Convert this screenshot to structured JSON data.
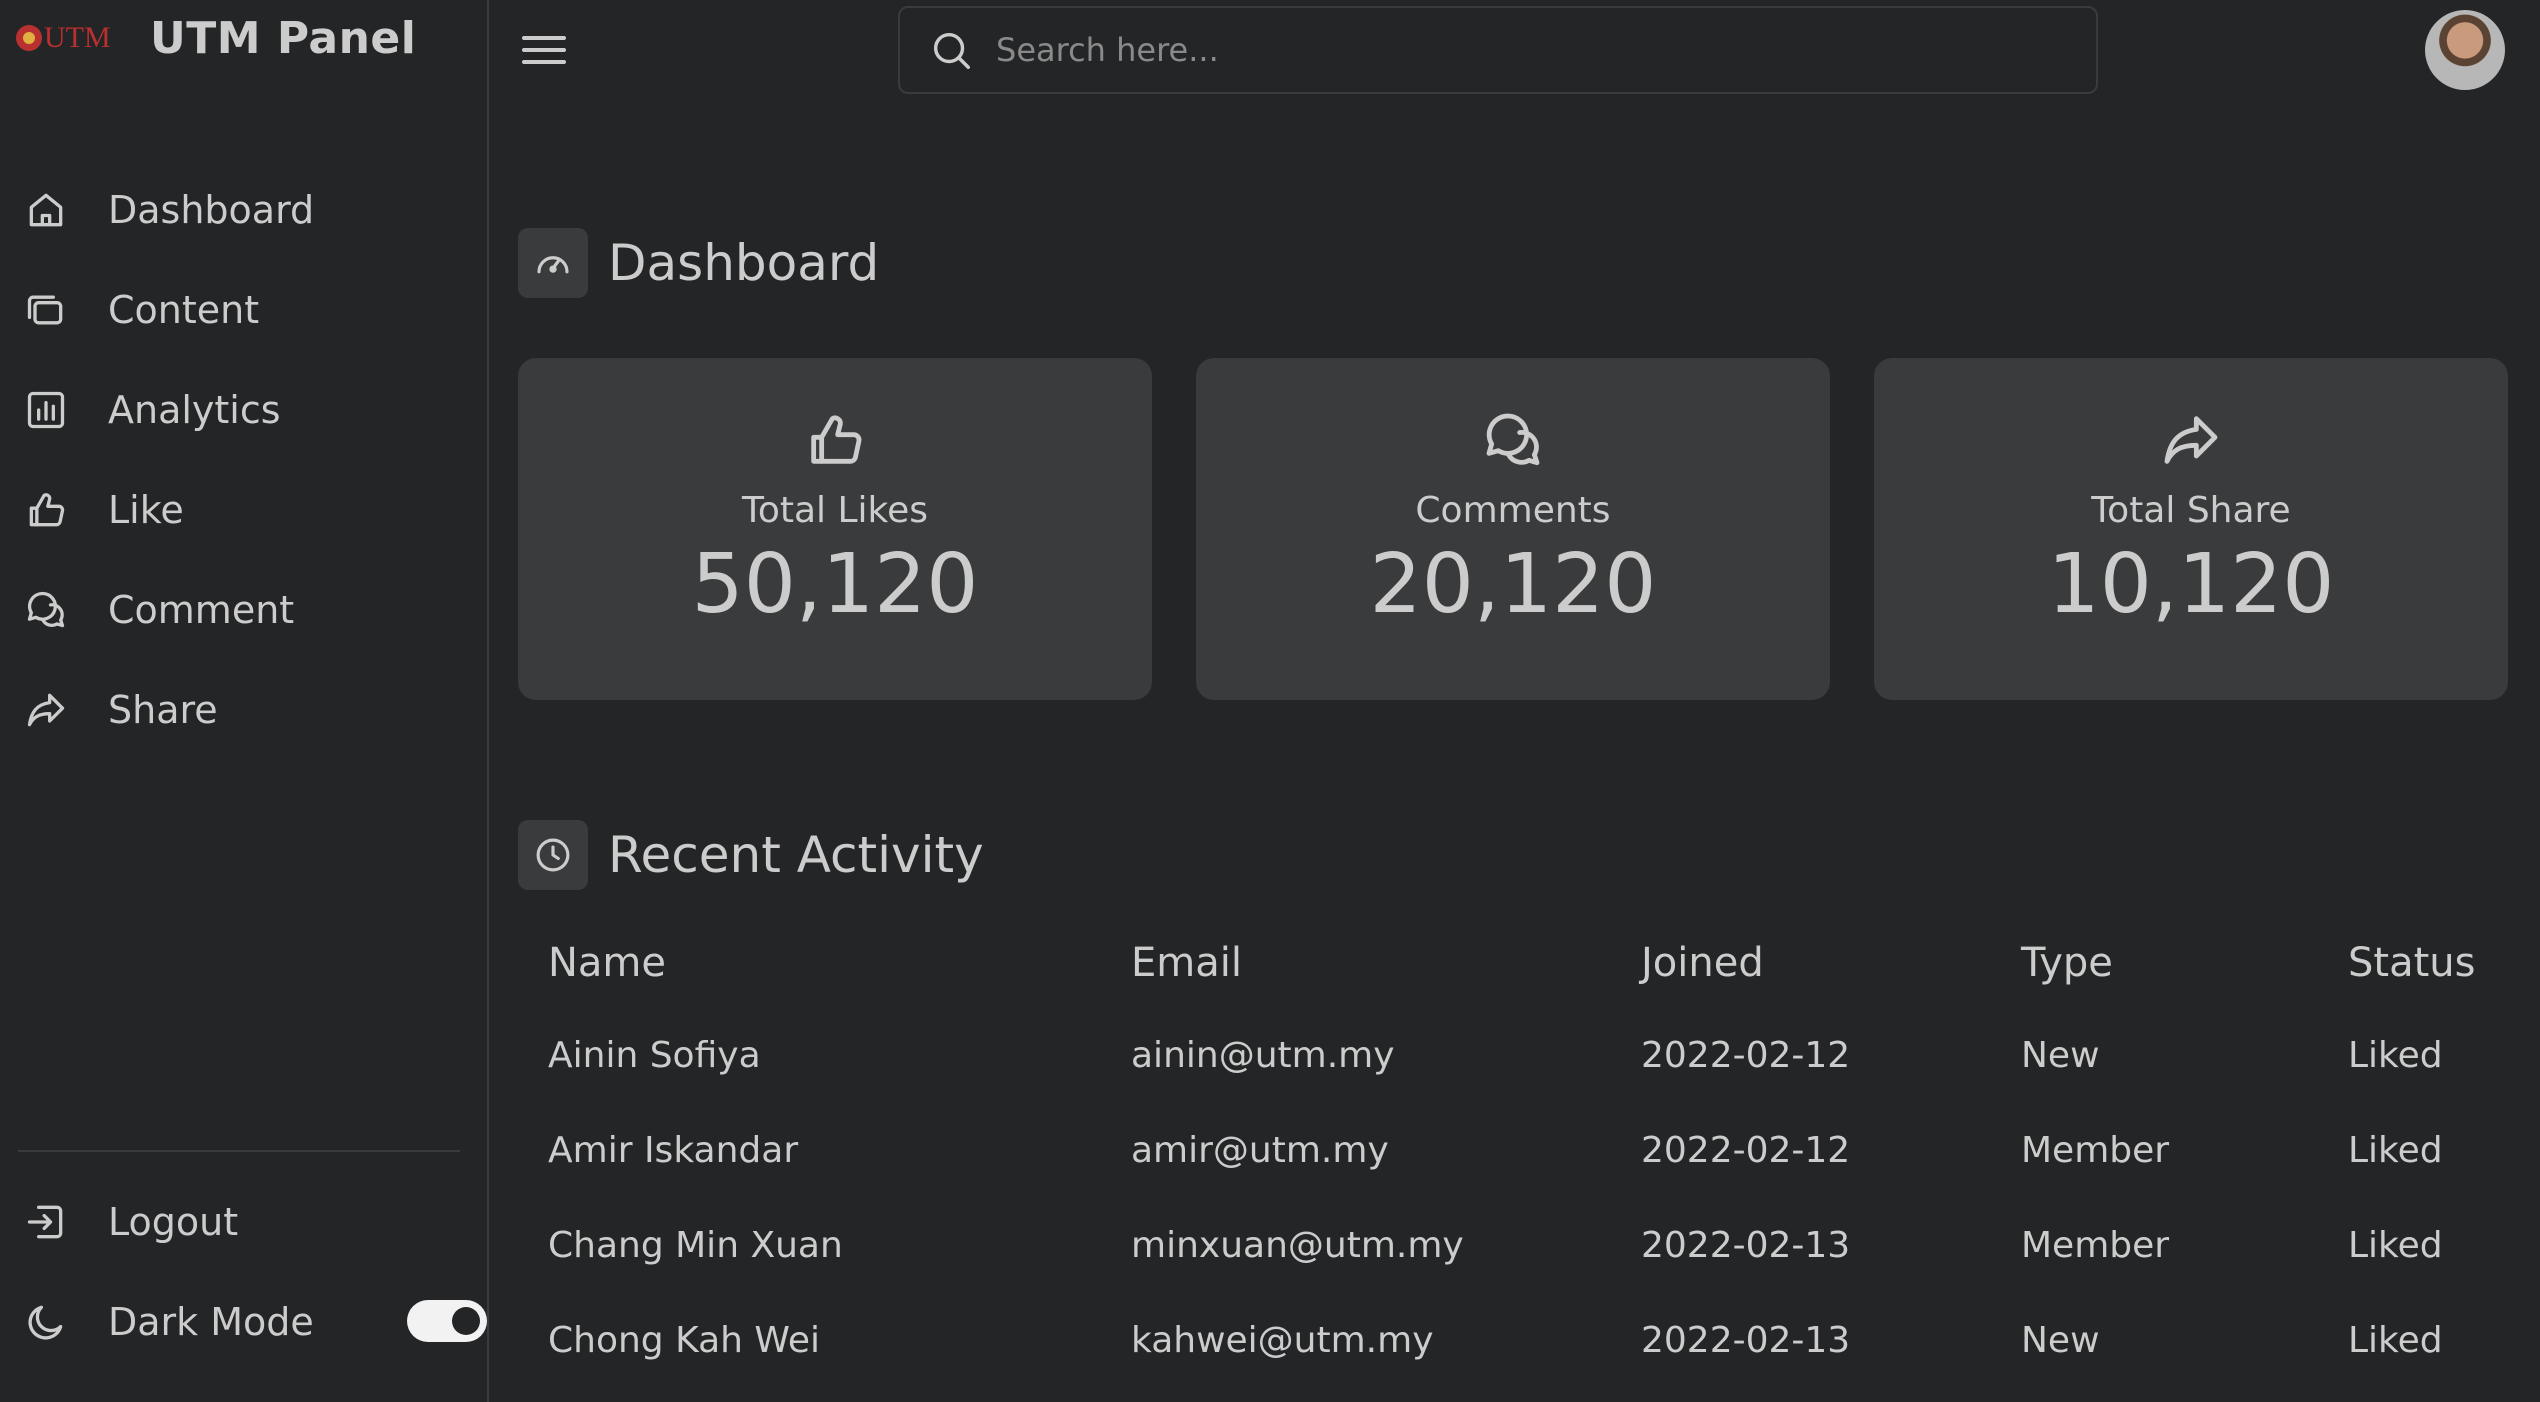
{
  "app": {
    "logo_text": "UTM",
    "title": "UTM Panel"
  },
  "colors": {
    "background": "#242526",
    "card": "#3a3b3c",
    "text": "#cccccc",
    "brand": "#b8302f"
  },
  "sidebar": {
    "items": [
      {
        "label": "Dashboard",
        "icon": "home-icon"
      },
      {
        "label": "Content",
        "icon": "files-icon"
      },
      {
        "label": "Analytics",
        "icon": "bar-chart-icon"
      },
      {
        "label": "Like",
        "icon": "thumbs-up-icon"
      },
      {
        "label": "Comment",
        "icon": "comments-icon"
      },
      {
        "label": "Share",
        "icon": "share-icon"
      }
    ],
    "logout": {
      "label": "Logout",
      "icon": "logout-icon"
    },
    "dark_mode": {
      "label": "Dark Mode",
      "icon": "moon-icon",
      "enabled": true
    }
  },
  "search": {
    "placeholder": "Search here..."
  },
  "dashboard": {
    "title": "Dashboard",
    "cards": [
      {
        "label": "Total Likes",
        "value": "50,120",
        "icon": "thumbs-up-icon"
      },
      {
        "label": "Comments",
        "value": "20,120",
        "icon": "comments-icon"
      },
      {
        "label": "Total Share",
        "value": "10,120",
        "icon": "share-icon"
      }
    ]
  },
  "activity": {
    "title": "Recent Activity",
    "columns": [
      "Name",
      "Email",
      "Joined",
      "Type",
      "Status"
    ],
    "rows": [
      [
        "Ainin Sofiya",
        "ainin@utm.my",
        "2022-02-12",
        "New",
        "Liked"
      ],
      [
        "Amir Iskandar",
        "amir@utm.my",
        "2022-02-12",
        "Member",
        "Liked"
      ],
      [
        "Chang Min Xuan",
        "minxuan@utm.my",
        "2022-02-13",
        "Member",
        "Liked"
      ],
      [
        "Chong Kah Wei",
        "kahwei@utm.my",
        "2022-02-13",
        "New",
        "Liked"
      ]
    ]
  }
}
